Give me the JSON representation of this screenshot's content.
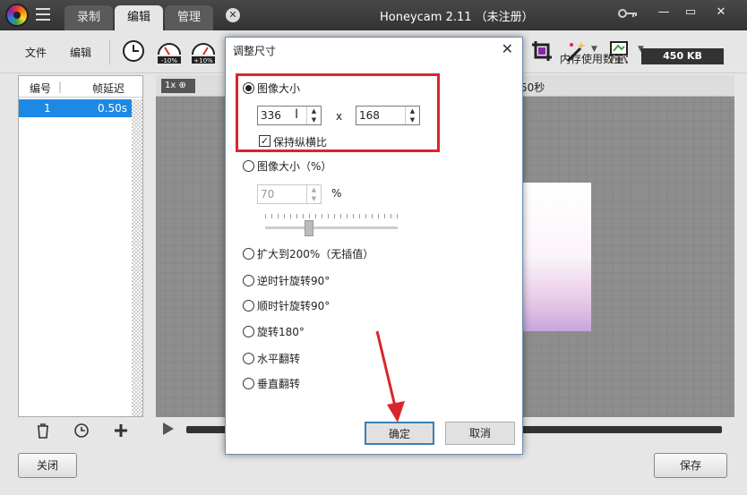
{
  "app": {
    "title": "Honeycam 2.11 （未注册）",
    "tabs": [
      "录制",
      "编辑",
      "管理"
    ],
    "window_controls": [
      "—",
      "▭",
      "✕"
    ]
  },
  "toolbar": {
    "file_label": "文件",
    "edit_label": "编辑",
    "speed_down_label": "-10%",
    "speed_up_label": "+10%",
    "seconds_label": "50秒",
    "memory_label": "内存使用数量：",
    "memory_value": "450 KB"
  },
  "framelist": {
    "col_index": "编号",
    "col_delay": "帧延迟",
    "rows": [
      {
        "index": "1",
        "delay": "0.50s"
      }
    ]
  },
  "canvas": {
    "zoom_label": "1x"
  },
  "dialog": {
    "title": "调整尺寸",
    "opt_size": "图像大小",
    "width_value": "336",
    "x_label": "x",
    "height_value": "168",
    "keep_ratio_label": "保持纵横比",
    "opt_percent": "图像大小（%）",
    "percent_value": "70",
    "percent_unit": "%",
    "opt_enlarge": "扩大到200%（无插值）",
    "opt_rotate_ccw": "逆时针旋转90°",
    "opt_rotate_cw": "顺时针旋转90°",
    "opt_rotate_180": "旋转180°",
    "opt_flip_h": "水平翻转",
    "opt_flip_v": "垂直翻转",
    "ok_label": "确定",
    "cancel_label": "取消"
  },
  "bottom": {
    "close_label": "关闭",
    "save_label": "保存"
  },
  "colors": {
    "accent": "#1e88e5",
    "highlight_box": "#d9262c",
    "titlebar": "#3a3a3a"
  },
  "icons": [
    "app-logo-icon",
    "menu-icon",
    "key-icon",
    "clock-icon",
    "speed-down-icon",
    "speed-up-icon",
    "crop-icon",
    "magic-wand-icon",
    "easel-icon",
    "zoom-in-icon",
    "trash-icon",
    "play-icon"
  ]
}
